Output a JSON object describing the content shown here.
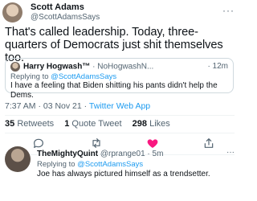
{
  "tweet": {
    "author_name": "Scott Adams",
    "author_handle": "@ScottAdamsSays",
    "more_label": "···",
    "text": "That's called leadership. Today, three-quarters of Democrats just shit themselves too.",
    "timestamp": "7:37 AM · 03 Nov 21 · ",
    "source": "Twitter Web App",
    "stats": {
      "retweets_count": "35",
      "retweets_label": "Retweets",
      "quotes_count": "1",
      "quotes_label": "Quote Tweet",
      "likes_count": "298",
      "likes_label": "Likes"
    }
  },
  "quoted": {
    "name": "Harry Hogwash™",
    "handle": "· NoHogwashN...",
    "time": "· 12m",
    "replying_prefix": "Replying to ",
    "replying_handle": "@ScottAdamsSays",
    "text": "I have a feeling that Biden shitting his pants didn't help the Dems."
  },
  "reply": {
    "name": "TheMightyQuint",
    "handle": "@rprange01",
    "time": "· 5m",
    "more_label": "···",
    "replying_prefix": "Replying to ",
    "replying_handle": "@ScottAdamsSays",
    "text": "Joe has always pictured himself as a trendsetter."
  },
  "actions": [
    {
      "icon": "reply-icon"
    },
    {
      "icon": "retweet-icon"
    },
    {
      "icon": "heart-icon",
      "color": "#f91880"
    },
    {
      "icon": "share-icon"
    }
  ],
  "colors": {
    "link": "#1d9bf0",
    "muted": "#536471",
    "like": "#f91880",
    "divider": "#eff3f4"
  }
}
